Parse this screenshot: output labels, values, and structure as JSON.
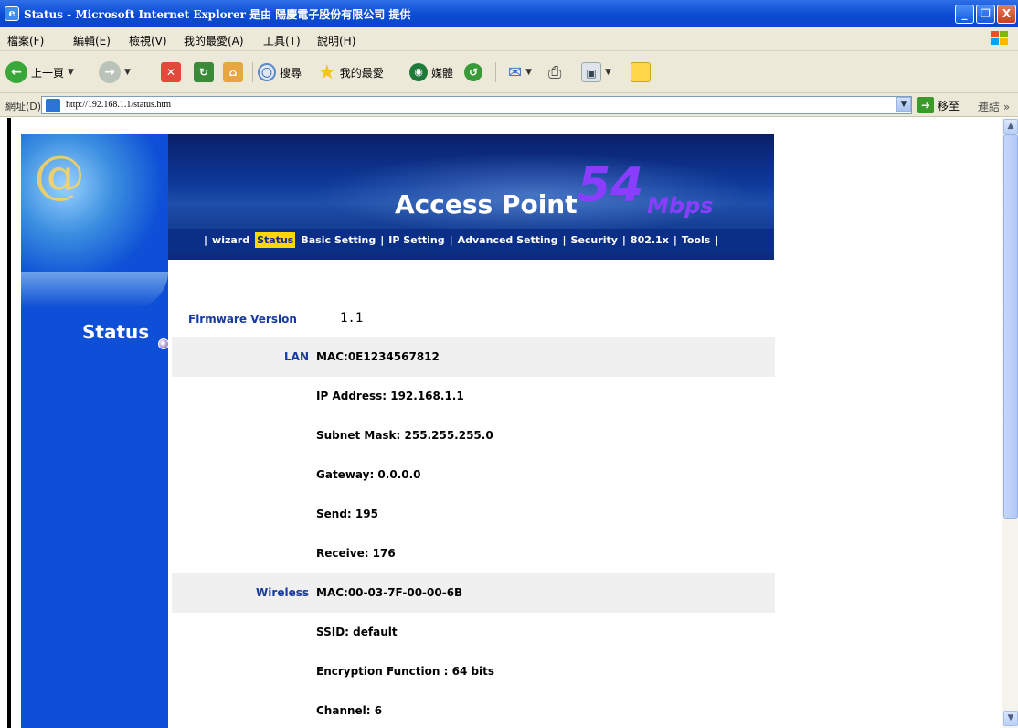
{
  "window": {
    "title": "Status - Microsoft Internet Explorer 是由 陽慶電子股份有限公司 提供",
    "minimize": "_",
    "restore": "❐",
    "close": "X"
  },
  "menu": [
    "檔案(F)",
    "編輯(E)",
    "檢視(V)",
    "我的最愛(A)",
    "工具(T)",
    "說明(H)"
  ],
  "toolbar": {
    "back_label": "上一頁",
    "search_label": "搜尋",
    "favorites_label": "我的最愛",
    "media_label": "媒體"
  },
  "address": {
    "label": "網址(D)",
    "url": "http://192.168.1.1/status.htm",
    "go_label": "移至",
    "links_label": "連結 »"
  },
  "banner": {
    "product_name": "Access Point",
    "speed": "54",
    "speed_unit": "Mbps"
  },
  "nav": [
    "wizard",
    "Status",
    "Basic Setting",
    "IP Setting",
    "Advanced Setting",
    "Security",
    "802.1x",
    "Tools"
  ],
  "nav_active": "Status",
  "sidebar": {
    "section_title": "Status"
  },
  "status": {
    "firmware_label": "Firmware Version",
    "firmware_value": "1.1",
    "lan_label": "LAN",
    "lan": {
      "mac": "MAC:0E1234567812",
      "ip": "IP Address: 192.168.1.1",
      "subnet": "Subnet Mask: 255.255.255.0",
      "gateway": "Gateway: 0.0.0.0",
      "send": "Send: 195",
      "receive": "Receive: 176"
    },
    "wireless_label": "Wireless",
    "wireless": {
      "mac": "MAC:00-03-7F-00-00-6B",
      "ssid": "SSID: default",
      "encryption": "Encryption Function : 64 bits",
      "channel": "Channel: 6"
    }
  },
  "colors": {
    "titlebar": "#0a4bd3",
    "chrome": "#ece9d8",
    "sidebar_blue": "#0d4fd6",
    "label_blue": "#173a9e",
    "nav_active": "#ffd800",
    "speed_purple": "#8a3cff"
  }
}
